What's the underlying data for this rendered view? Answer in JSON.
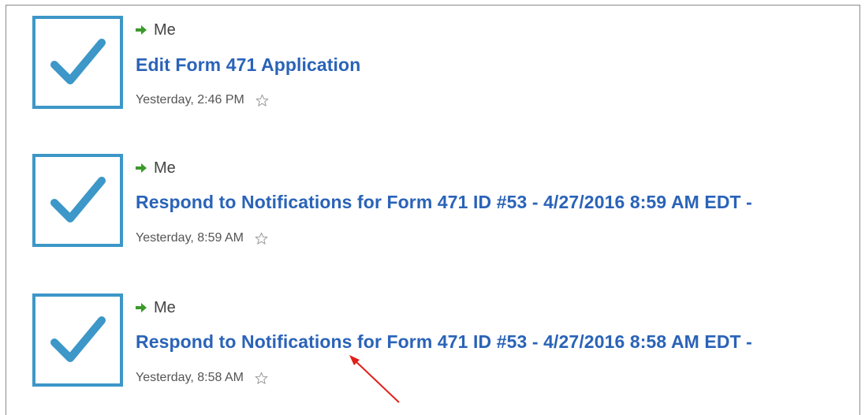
{
  "colors": {
    "accent": "#3d97c8",
    "link": "#2a63b8",
    "arrow_green": "#3c9a2c",
    "annotation": "#e0201a"
  },
  "tasks": [
    {
      "assignee": "Me",
      "title": "Edit Form 471 Application",
      "timestamp": "Yesterday, 2:46 PM",
      "status_icon": "checkmark-icon",
      "favorite_icon": "star-outline-icon"
    },
    {
      "assignee": "Me",
      "title": "Respond to Notifications for Form 471 ID #53 - 4/27/2016 8:59 AM EDT -",
      "timestamp": "Yesterday, 8:59 AM",
      "status_icon": "checkmark-icon",
      "favorite_icon": "star-outline-icon"
    },
    {
      "assignee": "Me",
      "title": "Respond to Notifications for Form 471 ID #53 - 4/27/2016 8:58 AM EDT -",
      "timestamp": "Yesterday, 8:58 AM",
      "status_icon": "checkmark-icon",
      "favorite_icon": "star-outline-icon"
    }
  ],
  "annotation": {
    "icon": "red-arrow-icon"
  }
}
